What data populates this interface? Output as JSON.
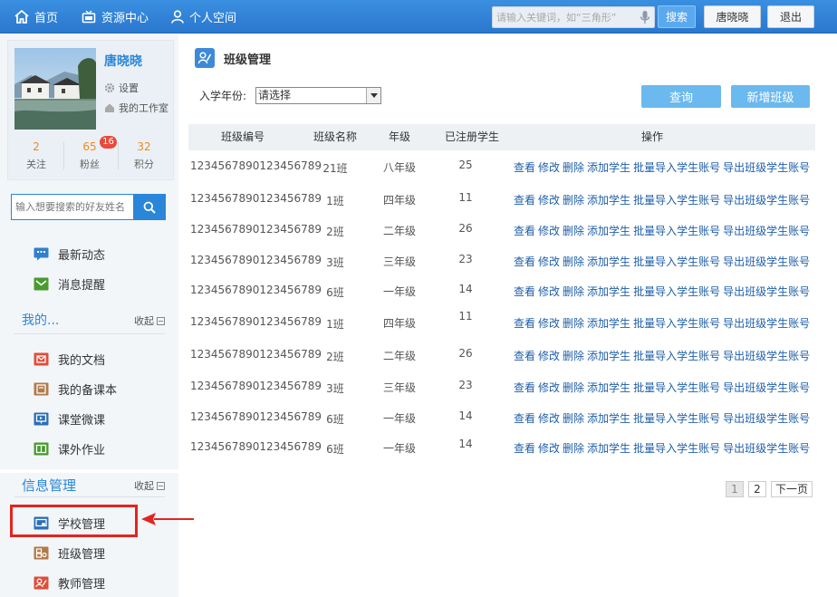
{
  "topbar": {
    "nav": [
      {
        "label": "首页",
        "icon": "home-icon"
      },
      {
        "label": "资源中心",
        "icon": "tv-icon"
      },
      {
        "label": "个人空间",
        "icon": "person-icon"
      }
    ],
    "search_placeholder": "请输入关键词，如“三角形”",
    "search_button": "搜索",
    "user_button": "唐晓晓",
    "logout_button": "退出",
    "accent_color": "#2a80d6"
  },
  "profile": {
    "name": "唐晓晓",
    "settings": "设置",
    "studio": "我的工作室",
    "stats": [
      {
        "value": "2",
        "label": "关注"
      },
      {
        "value": "65",
        "label": "粉丝",
        "badge": "16"
      },
      {
        "value": "32",
        "label": "积分"
      }
    ]
  },
  "friend_search": {
    "placeholder": "输入想要搜索的好友姓名"
  },
  "sidebar": {
    "top_items": [
      {
        "label": "最新动态",
        "icon": "chat-icon"
      },
      {
        "label": "消息提醒",
        "icon": "mail-icon"
      }
    ],
    "mine": {
      "title": "我的...",
      "collapse": "收起",
      "items": [
        {
          "label": "我的文档",
          "icon": "document-icon"
        },
        {
          "label": "我的备课本",
          "icon": "notebook-icon"
        },
        {
          "label": "课堂微课",
          "icon": "screen-icon"
        },
        {
          "label": "课外作业",
          "icon": "book-icon"
        }
      ]
    },
    "info": {
      "title": "信息管理",
      "collapse": "收起",
      "items": [
        {
          "label": "学校管理",
          "icon": "school-icon"
        },
        {
          "label": "班级管理",
          "icon": "class-icon"
        },
        {
          "label": "教师管理",
          "icon": "teacher-icon"
        }
      ]
    }
  },
  "main": {
    "title": "班级管理",
    "year_label": "入学年份:",
    "year_value": "请选择",
    "query_button": "查询",
    "add_button": "新增班级",
    "columns": [
      "班级编号",
      "班级名称",
      "年级",
      "已注册学生",
      "操作"
    ],
    "rows": [
      {
        "id": "1234567890123456789",
        "name": "21班",
        "grade": "八年级",
        "count": "25"
      },
      {
        "id": "1234567890123456789",
        "name": "1班",
        "grade": "四年级",
        "count": "11"
      },
      {
        "id": "1234567890123456789",
        "name": "2班",
        "grade": "二年级",
        "count": "26"
      },
      {
        "id": "1234567890123456789",
        "name": "3班",
        "grade": "三年级",
        "count": "23"
      },
      {
        "id": "1234567890123456789",
        "name": "6班",
        "grade": "一年级",
        "count": "14"
      },
      {
        "id": "1234567890123456789",
        "name": "1班",
        "grade": "四年级",
        "count": "11"
      },
      {
        "id": "1234567890123456789",
        "name": "2班",
        "grade": "二年级",
        "count": "26"
      },
      {
        "id": "1234567890123456789",
        "name": "3班",
        "grade": "三年级",
        "count": "23"
      },
      {
        "id": "1234567890123456789",
        "name": "6班",
        "grade": "一年级",
        "count": "14"
      },
      {
        "id": "1234567890123456789",
        "name": "6班",
        "grade": "一年级",
        "count": "14"
      }
    ],
    "actions": [
      "查看",
      "修改",
      "删除",
      "添加学生",
      "批量导入学生账号",
      "导出班级学生账号"
    ],
    "pagination": {
      "pages": [
        "1",
        "2"
      ],
      "current": "1",
      "next": "下一页"
    }
  },
  "annotation_color": "#e3251f"
}
